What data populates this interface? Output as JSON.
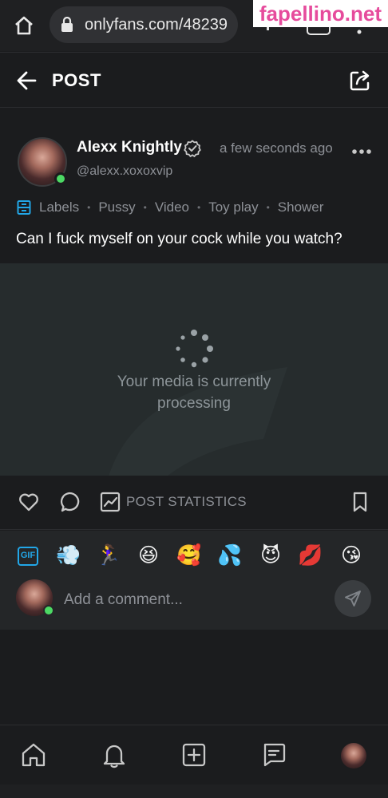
{
  "browser": {
    "url": "onlyfans.com/48239",
    "watermark": "fapellino.net"
  },
  "header": {
    "title": "POST"
  },
  "post": {
    "author_name": "Alexx Knightly",
    "author_handle": "@alexx.xoxoxvip",
    "time": "a few seconds ago",
    "labels": [
      "Labels",
      "Pussy",
      "Video",
      "Toy play",
      "Shower"
    ],
    "text": "Can I fuck myself on your cock while you watch?",
    "media_status": "Your media is currently processing"
  },
  "actions": {
    "stats_label": "POST STATISTICS"
  },
  "composer": {
    "gif_label": "GIF",
    "emojis": [
      "💨",
      "🏃‍♀️",
      "😆",
      "🥰",
      "💦",
      "😈",
      "💋",
      "😘"
    ],
    "placeholder": "Add a comment..."
  },
  "colors": {
    "accent": "#22a7e8",
    "online": "#4cd964",
    "watermark": "#e64b9c"
  }
}
